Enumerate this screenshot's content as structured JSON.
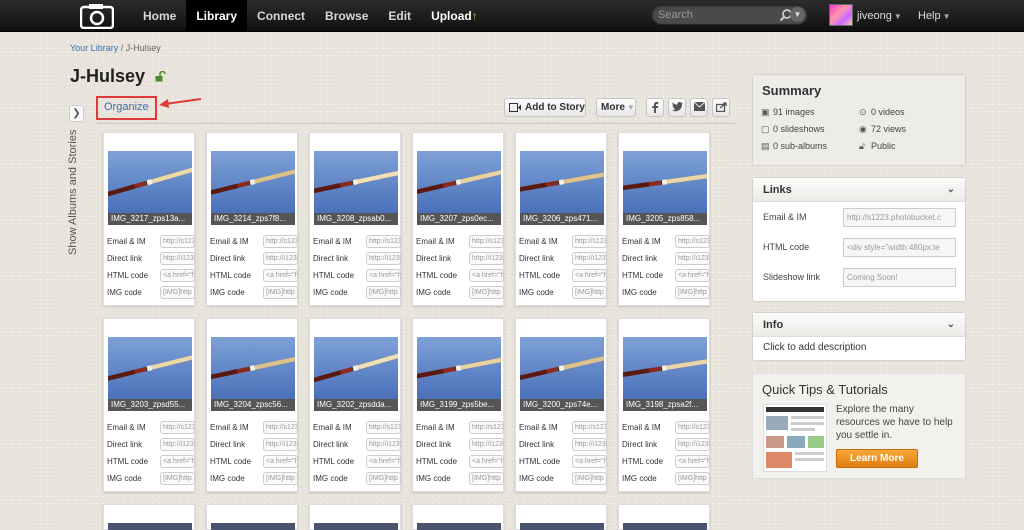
{
  "nav": {
    "items": [
      {
        "label": "Home",
        "active": false
      },
      {
        "label": "Library",
        "active": true
      },
      {
        "label": "Connect",
        "active": false
      },
      {
        "label": "Browse",
        "active": false
      },
      {
        "label": "Edit",
        "active": false
      },
      {
        "label": "Upload",
        "active": false
      }
    ],
    "search_placeholder": "Search",
    "username": "jiveong",
    "help": "Help"
  },
  "breadcrumb": {
    "root": "Your Library",
    "sep": "/",
    "current": "J-Hulsey"
  },
  "album": {
    "title": "J-Hulsey"
  },
  "sidebar": {
    "toggle_label": "Show Albums and Stories"
  },
  "toolbar": {
    "organize": "Organize",
    "add_to_story": "Add to Story",
    "more": "More"
  },
  "field_labels": {
    "email_im": "Email & IM",
    "direct_link": "Direct link",
    "html_code": "HTML code",
    "img_code": "IMG code"
  },
  "field_values": {
    "email_im": "http://s123",
    "direct_link": "http://i123",
    "html_code": "<a href=\"h",
    "img_code": "[IMG]http"
  },
  "photos": [
    {
      "name": "IMG_3217_zps13a..."
    },
    {
      "name": "IMG_3214_zps7f8..."
    },
    {
      "name": "IMG_3208_zpsab0..."
    },
    {
      "name": "IMG_3207_zps0ec..."
    },
    {
      "name": "IMG_3206_zps471..."
    },
    {
      "name": "IMG_3205_zps858..."
    },
    {
      "name": "IMG_3203_zpsd55..."
    },
    {
      "name": "IMG_3204_zpsc56..."
    },
    {
      "name": "IMG_3202_zpsdda..."
    },
    {
      "name": "IMG_3199_zps5be..."
    },
    {
      "name": "IMG_3200_zps74e..."
    },
    {
      "name": "IMG_3198_zpsa2f..."
    }
  ],
  "summary": {
    "title": "Summary",
    "images": "91 images",
    "videos": "0 videos",
    "slideshows": "0 slideshows",
    "views": "72 views",
    "subalbums": "0 sub-albums",
    "privacy": "Public"
  },
  "links": {
    "title": "Links",
    "email_label": "Email & IM",
    "email_value": "http://s1223.photobucket.c",
    "html_label": "HTML code",
    "html_value": "<div style=\"width:480px;te",
    "slideshow_label": "Slideshow link",
    "slideshow_value": "Coming Soon!"
  },
  "info": {
    "title": "Info",
    "description": "Click to add description"
  },
  "tips": {
    "title": "Quick Tips & Tutorials",
    "text": "Explore the many resources we have to help you settle in.",
    "button": "Learn More"
  }
}
